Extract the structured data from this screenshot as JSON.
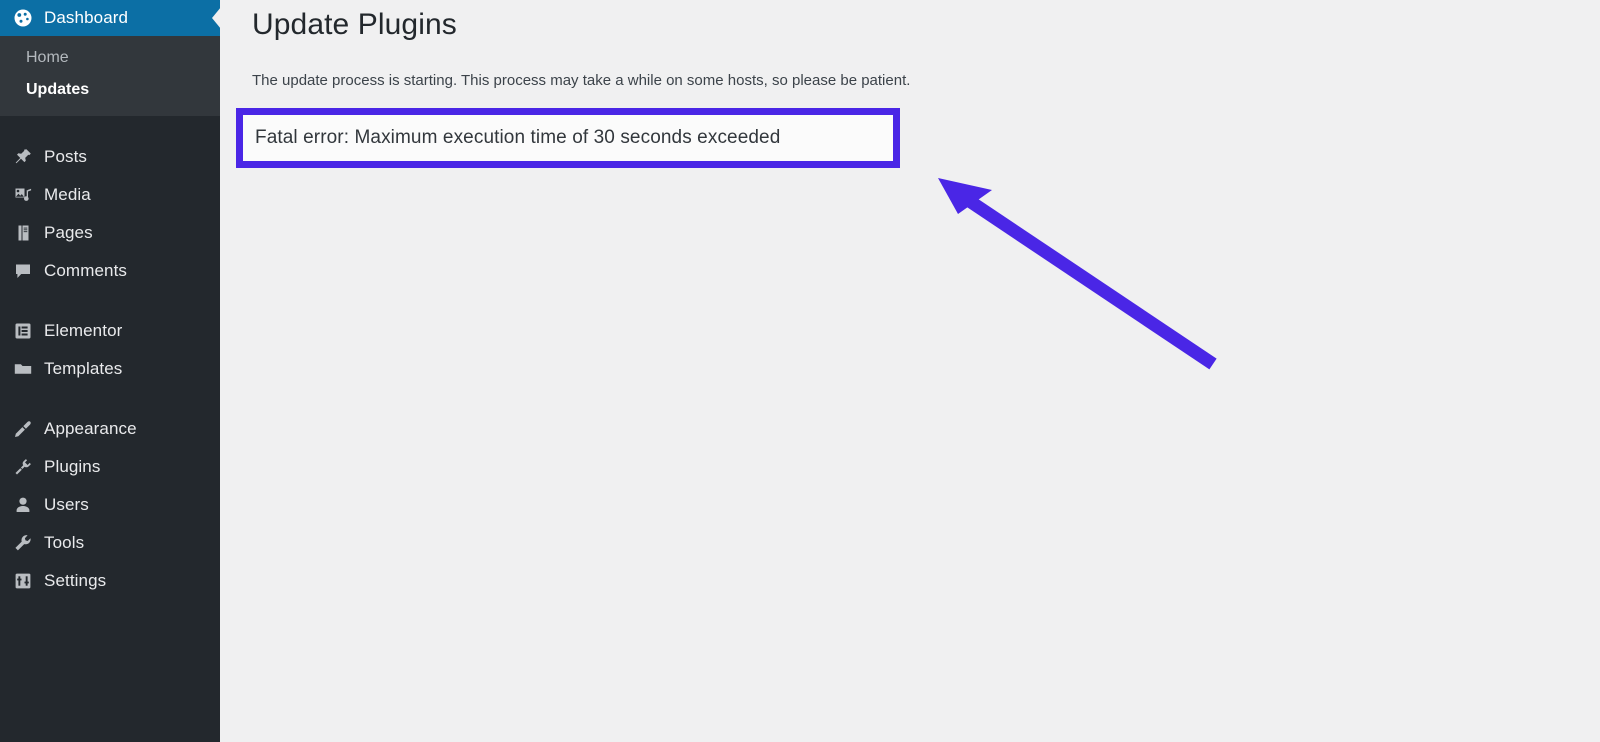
{
  "sidebar": {
    "items": [
      {
        "label": "Dashboard",
        "icon": "dashboard-icon",
        "current": true,
        "name": "dashboard"
      },
      {
        "label": "Posts",
        "icon": "pin-icon",
        "current": false,
        "name": "posts"
      },
      {
        "label": "Media",
        "icon": "media-icon",
        "current": false,
        "name": "media"
      },
      {
        "label": "Pages",
        "icon": "pages-icon",
        "current": false,
        "name": "pages"
      },
      {
        "label": "Comments",
        "icon": "comments-icon",
        "current": false,
        "name": "comments"
      },
      {
        "label": "Elementor",
        "icon": "elementor-icon",
        "current": false,
        "name": "elementor"
      },
      {
        "label": "Templates",
        "icon": "folder-icon",
        "current": false,
        "name": "templates"
      },
      {
        "label": "Appearance",
        "icon": "paintbrush-icon",
        "current": false,
        "name": "appearance"
      },
      {
        "label": "Plugins",
        "icon": "plug-icon",
        "current": false,
        "name": "plugins"
      },
      {
        "label": "Users",
        "icon": "user-icon",
        "current": false,
        "name": "users"
      },
      {
        "label": "Tools",
        "icon": "wrench-icon",
        "current": false,
        "name": "tools"
      },
      {
        "label": "Settings",
        "icon": "settings-icon",
        "current": false,
        "name": "settings"
      }
    ],
    "submenu": [
      {
        "label": "Home",
        "current": false
      },
      {
        "label": "Updates",
        "current": true
      }
    ]
  },
  "main": {
    "title": "Update Plugins",
    "intro": "The update process is starting. This process may take a while on some hosts, so please be patient.",
    "error_message": "Fatal error: Maximum execution time of 30 seconds exceeded"
  },
  "annotation": {
    "highlight_color": "#4a26e6",
    "arrow_color": "#4a26e6",
    "arrow_tip": "942,182",
    "arrow_tail": "1213,364"
  },
  "colors": {
    "sidebar_bg": "#23282d",
    "submenu_bg": "#32373c",
    "current_item_bg": "#0c6fa5",
    "content_bg": "#f0f0f1",
    "error_box_bg": "#fbfbfb"
  }
}
